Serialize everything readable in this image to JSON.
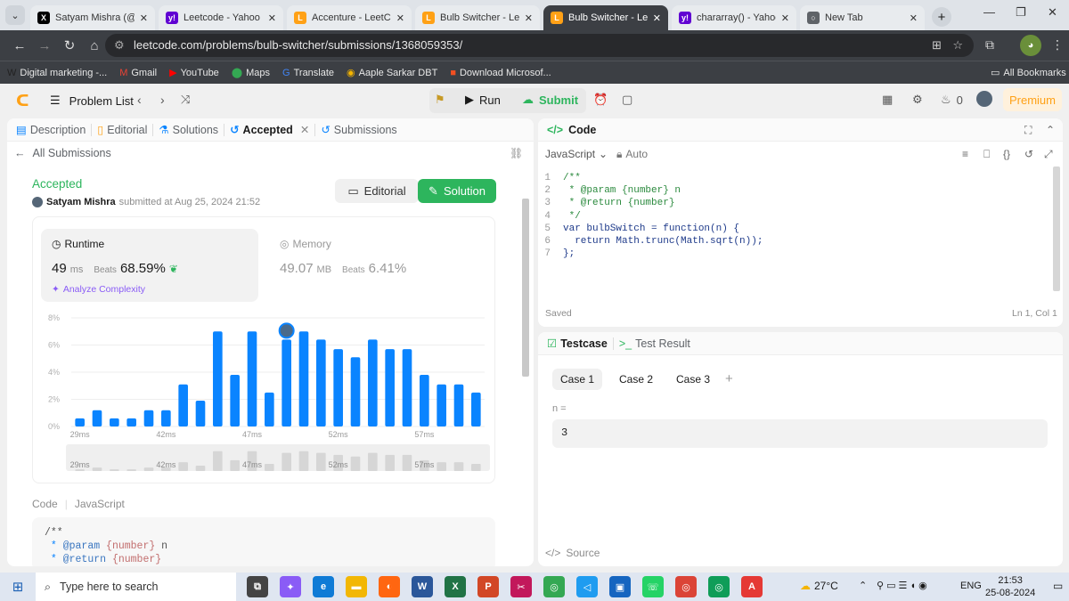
{
  "browser": {
    "tabs": [
      {
        "title": "Satyam Mishra (@its",
        "favicon": "x-icon",
        "color": "#000000",
        "glyph": "X"
      },
      {
        "title": "Leetcode - Yahoo Ind",
        "favicon": "yahoo-icon",
        "color": "#6001d2",
        "glyph": "y!"
      },
      {
        "title": "Accenture - LeetCode",
        "favicon": "leetcode-icon",
        "color": "#ffa116",
        "glyph": "L"
      },
      {
        "title": "Bulb Switcher - LeetC",
        "favicon": "leetcode-icon",
        "color": "#ffa116",
        "glyph": "L"
      },
      {
        "title": "Bulb Switcher - LeetC",
        "favicon": "leetcode-icon",
        "color": "#ffa116",
        "glyph": "L",
        "active": true
      },
      {
        "title": "chararray() - Yahoo I",
        "favicon": "yahoo-icon",
        "color": "#6001d2",
        "glyph": "y!"
      },
      {
        "title": "New Tab",
        "favicon": "chrome-icon",
        "color": "#5f6368",
        "glyph": "○"
      }
    ],
    "url": "leetcode.com/problems/bulb-switcher/submissions/1368059353/",
    "bookmarks": [
      {
        "label": "Digital marketing -...",
        "color": "#222222",
        "glyph": "W"
      },
      {
        "label": "Gmail",
        "color": "#ea4335",
        "glyph": "M"
      },
      {
        "label": "YouTube",
        "color": "#ff0000",
        "glyph": "▶"
      },
      {
        "label": "Maps",
        "color": "#34a853",
        "glyph": "⬤"
      },
      {
        "label": "Translate",
        "color": "#4285f4",
        "glyph": "G"
      },
      {
        "label": "Aaple Sarkar DBT",
        "color": "#f4b400",
        "glyph": "◉"
      },
      {
        "label": "Download Microsof...",
        "color": "#f25022",
        "glyph": "■"
      }
    ],
    "all_bookmarks": "All Bookmarks"
  },
  "header": {
    "problem_list": "Problem List",
    "run": "Run",
    "submit": "Submit",
    "streak": "0",
    "premium": "Premium"
  },
  "left_tabs": {
    "description": "Description",
    "editorial": "Editorial",
    "solutions": "Solutions",
    "accepted": "Accepted",
    "submissions": "Submissions"
  },
  "submission": {
    "back_label": "All Submissions",
    "status": "Accepted",
    "user": "Satyam Mishra",
    "submitted_text": "submitted at Aug 25, 2024 21:52",
    "editorial_btn": "Editorial",
    "solution_btn": "Solution",
    "runtime_label": "Runtime",
    "runtime_value": "49",
    "runtime_unit": "ms",
    "beats_label": "Beats",
    "runtime_beats": "68.59%",
    "memory_label": "Memory",
    "memory_value": "49.07",
    "memory_unit": "MB",
    "memory_beats": "6.41%",
    "analyze": "Analyze Complexity",
    "code_label": "Code",
    "code_lang": "JavaScript",
    "code_preview": [
      "/**",
      " * @param {number} n",
      " * @return {number}"
    ]
  },
  "chart_data": {
    "type": "bar",
    "yticks": [
      "8%",
      "6%",
      "4%",
      "2%",
      "0%"
    ],
    "ylim": [
      0,
      8
    ],
    "xticks": [
      "29ms",
      "42ms",
      "47ms",
      "52ms",
      "57ms"
    ],
    "values": [
      0.6,
      1.2,
      0.6,
      0.6,
      1.2,
      1.2,
      3.1,
      1.9,
      7.0,
      3.8,
      7.0,
      2.5,
      6.4,
      7.0,
      6.4,
      5.7,
      5.1,
      6.4,
      5.7,
      5.7,
      3.8,
      3.1,
      3.1,
      2.5
    ],
    "highlight_index": 12,
    "grid": true
  },
  "code_panel": {
    "title": "Code",
    "language": "JavaScript",
    "mode": "Auto",
    "saved": "Saved",
    "cursor": "Ln 1, Col 1",
    "lines": [
      {
        "num": "1",
        "text": "/**"
      },
      {
        "num": "2",
        "text": " * @param {number} n"
      },
      {
        "num": "3",
        "text": " * @return {number}"
      },
      {
        "num": "4",
        "text": " */"
      },
      {
        "num": "5",
        "text": "var bulbSwitch = function(n) {"
      },
      {
        "num": "6",
        "text": "  return Math.trunc(Math.sqrt(n));"
      },
      {
        "num": "7",
        "text": "};"
      }
    ]
  },
  "test_panel": {
    "testcase": "Testcase",
    "result": "Test Result",
    "cases": [
      "Case 1",
      "Case 2",
      "Case 3"
    ],
    "var_label": "n =",
    "var_value": "3",
    "source": "Source"
  },
  "taskbar": {
    "search": "Type here to search",
    "weather": "27°C",
    "lang": "ENG",
    "time": "21:53",
    "date": "25-08-2024",
    "apps": [
      {
        "name": "task-view-icon",
        "color": "#444444",
        "glyph": "⧉"
      },
      {
        "name": "copilot-icon",
        "color": "#8a5cf6",
        "glyph": "✦"
      },
      {
        "name": "edge-icon",
        "color": "#0f7bd6",
        "glyph": "e"
      },
      {
        "name": "file-explorer-icon",
        "color": "#f2b705",
        "glyph": "▬"
      },
      {
        "name": "firefox-icon",
        "color": "#ff6611",
        "glyph": "◐"
      },
      {
        "name": "word-icon",
        "color": "#2b579a",
        "glyph": "W"
      },
      {
        "name": "excel-icon",
        "color": "#217346",
        "glyph": "X"
      },
      {
        "name": "powerpoint-icon",
        "color": "#d24726",
        "glyph": "P"
      },
      {
        "name": "snipping-icon",
        "color": "#c2185b",
        "glyph": "✂"
      },
      {
        "name": "chrome-icon",
        "color": "#34a853",
        "glyph": "◎"
      },
      {
        "name": "vscode-icon",
        "color": "#1f9cf0",
        "glyph": "◁"
      },
      {
        "name": "app-icon",
        "color": "#1565c0",
        "glyph": "▣"
      },
      {
        "name": "whatsapp-icon",
        "color": "#25d366",
        "glyph": "☏"
      },
      {
        "name": "chrome-profile-icon",
        "color": "#db4437",
        "glyph": "◎"
      },
      {
        "name": "chrome-profile2-icon",
        "color": "#0f9d58",
        "glyph": "◎"
      },
      {
        "name": "pdf-icon",
        "color": "#e53935",
        "glyph": "A"
      }
    ]
  }
}
